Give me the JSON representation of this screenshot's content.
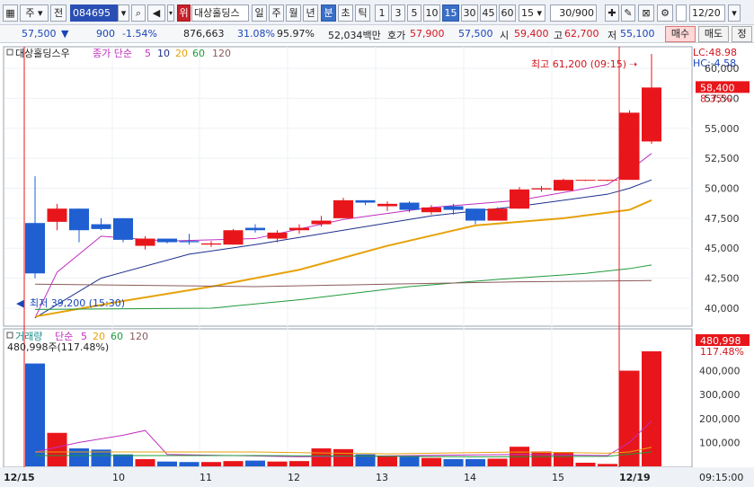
{
  "toolbar": {
    "type_sel": "주",
    "prev_label": "전",
    "code": "084695",
    "warn_badge": "위",
    "name": "대상홀딩스",
    "period_tabs": [
      "일",
      "주",
      "월",
      "년",
      "분",
      "초",
      "틱"
    ],
    "period_active": "분",
    "interval_tabs": [
      "1",
      "3",
      "5",
      "10",
      "15",
      "30",
      "45",
      "60"
    ],
    "interval_active": "15",
    "interval_value": "15",
    "count": "30/900",
    "date": "12/20"
  },
  "quote": {
    "price": "57,500",
    "change": "900",
    "change_pct": "-1.54%",
    "volume": "876,663",
    "turnover_pct": "31.08%",
    "strength": "95.97%",
    "amount": "52,034백만",
    "bid_ask_label": "호가",
    "ask": "57,900",
    "bid": "57,500",
    "open_label": "시",
    "open": "59,400",
    "high_label": "고",
    "high": "62,700",
    "low_label": "저",
    "low": "55,100",
    "buy_label": "매수",
    "sell_label": "매도",
    "last_label": "정"
  },
  "price_panel": {
    "legend_name": "대상홀딩스우",
    "legend_type": "종가 단순",
    "ma_labels": [
      "5",
      "10",
      "20",
      "60",
      "120"
    ],
    "lc": "LC:48.98",
    "hc": "HC:-4.58",
    "high_note": "최고 61,200 (09:15)",
    "low_note": "최저 39,200 (15:30)",
    "current": "58,400",
    "current_pct": "8.35%",
    "y_ticks": [
      "60,000",
      "57,500",
      "55,000",
      "52,500",
      "50,000",
      "47,500",
      "45,000",
      "42,500",
      "40,000"
    ]
  },
  "volume_panel": {
    "legend_name": "거래량",
    "legend_type": "단순",
    "ma_labels": [
      "5",
      "20",
      "60",
      "120"
    ],
    "last_note": "480,998주(117.48%)",
    "current": "480,998",
    "current_pct": "117.48%",
    "y_ticks": [
      "400,000",
      "300,000",
      "200,000",
      "100,000"
    ]
  },
  "x_axis": {
    "labels": [
      "12/15",
      "10",
      "11",
      "12",
      "13",
      "14",
      "15",
      "12/19"
    ],
    "time": "09:15:00"
  },
  "colors": {
    "up": "#e8161b",
    "down": "#1f5fd1",
    "ma5": "#c02fc0",
    "ma10": "#1d2f8c",
    "ma20": "#e6a20a",
    "ma60": "#1d9a3a",
    "ma120": "#8c5a5a"
  },
  "chart_data": {
    "type": "candlestick",
    "candles": [
      {
        "o": 47100,
        "h": 51000,
        "l": 42500,
        "c": 42900
      },
      {
        "o": 47200,
        "h": 48700,
        "l": 46500,
        "c": 48300
      },
      {
        "o": 48300,
        "h": 48300,
        "l": 45500,
        "c": 46500
      },
      {
        "o": 47000,
        "h": 47500,
        "l": 46500,
        "c": 46600
      },
      {
        "o": 47500,
        "h": 47500,
        "l": 45500,
        "c": 45700
      },
      {
        "o": 45200,
        "h": 46000,
        "l": 44900,
        "c": 45800
      },
      {
        "o": 45800,
        "h": 45800,
        "l": 45400,
        "c": 45500
      },
      {
        "o": 45600,
        "h": 46200,
        "l": 45300,
        "c": 45500
      },
      {
        "o": 45300,
        "h": 45600,
        "l": 45100,
        "c": 45400
      },
      {
        "o": 45300,
        "h": 46600,
        "l": 45300,
        "c": 46500
      },
      {
        "o": 46700,
        "h": 47000,
        "l": 46300,
        "c": 46500
      },
      {
        "o": 45800,
        "h": 46500,
        "l": 45500,
        "c": 46300
      },
      {
        "o": 46500,
        "h": 47000,
        "l": 46200,
        "c": 46700
      },
      {
        "o": 47000,
        "h": 47700,
        "l": 46800,
        "c": 47300
      },
      {
        "o": 47500,
        "h": 49200,
        "l": 47500,
        "c": 49000
      },
      {
        "o": 49000,
        "h": 49000,
        "l": 48600,
        "c": 48800
      },
      {
        "o": 48500,
        "h": 48900,
        "l": 48100,
        "c": 48700
      },
      {
        "o": 48800,
        "h": 48900,
        "l": 48000,
        "c": 48200
      },
      {
        "o": 48000,
        "h": 48600,
        "l": 47800,
        "c": 48400
      },
      {
        "o": 48500,
        "h": 48700,
        "l": 47800,
        "c": 48200
      },
      {
        "o": 48300,
        "h": 48300,
        "l": 47000,
        "c": 47300
      },
      {
        "o": 47300,
        "h": 48400,
        "l": 47300,
        "c": 48300
      },
      {
        "o": 48300,
        "h": 50100,
        "l": 48300,
        "c": 49900
      },
      {
        "o": 49900,
        "h": 50200,
        "l": 49700,
        "c": 50000
      },
      {
        "o": 49800,
        "h": 50800,
        "l": 49800,
        "c": 50700
      },
      {
        "o": 50700,
        "h": 50700,
        "l": 50600,
        "c": 50700
      },
      {
        "o": 50700,
        "h": 50700,
        "l": 50600,
        "c": 50700
      },
      {
        "o": 50700,
        "h": 56500,
        "l": 50700,
        "c": 56300
      },
      {
        "o": 53900,
        "h": 61200,
        "l": 53700,
        "c": 58400
      }
    ],
    "volume": [
      430000,
      140000,
      75000,
      70000,
      50000,
      30000,
      20000,
      18000,
      18000,
      22000,
      24000,
      20000,
      22000,
      75000,
      72000,
      50000,
      45000,
      40000,
      35000,
      30000,
      30000,
      32000,
      82000,
      62000,
      60000,
      15000,
      10000,
      400000,
      480998
    ],
    "ma": {
      "5": [
        [
          0,
          39200
        ],
        [
          1,
          43000
        ],
        [
          3,
          46000
        ],
        [
          6,
          45600
        ],
        [
          10,
          45800
        ],
        [
          14,
          47400
        ],
        [
          18,
          48400
        ],
        [
          22,
          49000
        ],
        [
          26,
          50300
        ],
        [
          27,
          51500
        ],
        [
          28,
          52900
        ]
      ],
      "10": [
        [
          0,
          39200
        ],
        [
          3,
          42500
        ],
        [
          7,
          44500
        ],
        [
          10,
          45300
        ],
        [
          14,
          46500
        ],
        [
          18,
          47700
        ],
        [
          22,
          48500
        ],
        [
          26,
          49500
        ],
        [
          27,
          50000
        ],
        [
          28,
          50700
        ]
      ],
      "20": [
        [
          0,
          39300
        ],
        [
          4,
          40600
        ],
        [
          8,
          41800
        ],
        [
          12,
          43200
        ],
        [
          16,
          45200
        ],
        [
          20,
          46900
        ],
        [
          24,
          47500
        ],
        [
          27,
          48200
        ],
        [
          28,
          49000
        ]
      ],
      "60": [
        [
          0,
          39900
        ],
        [
          8,
          40000
        ],
        [
          12,
          40700
        ],
        [
          17,
          41800
        ],
        [
          21,
          42400
        ],
        [
          25,
          42900
        ],
        [
          27,
          43300
        ],
        [
          28,
          43600
        ]
      ],
      "120": [
        [
          0,
          42000
        ],
        [
          10,
          41800
        ],
        [
          16,
          42000
        ],
        [
          22,
          42200
        ],
        [
          28,
          42300
        ]
      ]
    },
    "volume_ma": {
      "5": [
        [
          0,
          60000
        ],
        [
          2,
          100000
        ],
        [
          4,
          130000
        ],
        [
          5,
          150000
        ],
        [
          6,
          50000
        ],
        [
          12,
          40000
        ],
        [
          22,
          50000
        ],
        [
          26,
          45000
        ],
        [
          27,
          100000
        ],
        [
          28,
          190000
        ]
      ],
      "20": [
        [
          0,
          60000
        ],
        [
          10,
          60000
        ],
        [
          16,
          52000
        ],
        [
          22,
          60000
        ],
        [
          26,
          55000
        ],
        [
          27,
          60000
        ],
        [
          28,
          80000
        ]
      ],
      "60": [
        [
          0,
          45000
        ],
        [
          10,
          45000
        ],
        [
          20,
          40000
        ],
        [
          26,
          42000
        ],
        [
          28,
          60000
        ]
      ]
    },
    "ylim": [
      38500,
      61800
    ],
    "vol_ylim": [
      0,
      480998
    ]
  }
}
